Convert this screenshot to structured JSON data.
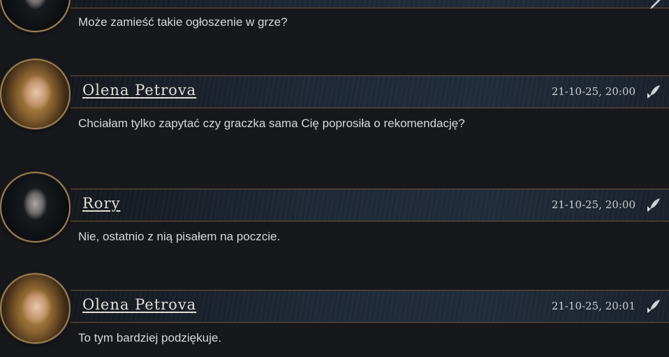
{
  "posts": [
    {
      "author": "",
      "timestamp": "",
      "avatar": "rory-portrait",
      "message": "Może zamieść takie ogłoszenie w grze?"
    },
    {
      "author": "Olena Petrova",
      "timestamp": "21-10-25, 20:00",
      "avatar": "olena-portrait",
      "message": "Chciałam tylko zapytać czy graczka sama Cię poprosiła o rekomendację?"
    },
    {
      "author": "Rory",
      "timestamp": "21-10-25, 20:00",
      "avatar": "rory-portrait",
      "message": "Nie, ostatnio z nią pisałem na poczcie."
    },
    {
      "author": "Olena Petrova",
      "timestamp": "21-10-25, 20:01",
      "avatar": "olena-portrait",
      "message": "To tym bardziej podziękuje."
    }
  ],
  "icons": {
    "quote": "quill-icon"
  },
  "colors": {
    "background": "#17181c",
    "frame_gold": "#9a7f55",
    "header_blue": "#1f2937",
    "text": "#d6d8db"
  }
}
